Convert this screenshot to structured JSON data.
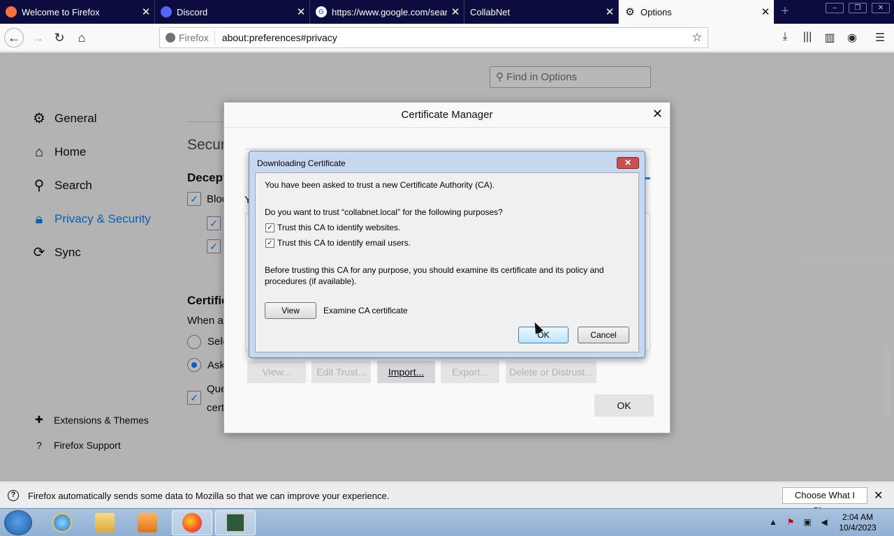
{
  "tabs": [
    {
      "title": "Welcome to Firefox",
      "icon": "firefox-icon"
    },
    {
      "title": "Discord",
      "icon": "discord-icon"
    },
    {
      "title": "https://www.google.com/sear",
      "icon": "google-icon"
    },
    {
      "title": "CollabNet",
      "icon": ""
    },
    {
      "title": "Options",
      "icon": "gear-icon"
    }
  ],
  "urlbar": {
    "identity": "Firefox",
    "url": "about:preferences#privacy"
  },
  "find": {
    "placeholder": "Find in Options"
  },
  "categories": [
    {
      "label": "General",
      "icon": "gear-icon"
    },
    {
      "label": "Home",
      "icon": "home-icon"
    },
    {
      "label": "Search",
      "icon": "search-icon"
    },
    {
      "label": "Privacy & Security",
      "icon": "lock-icon"
    },
    {
      "label": "Sync",
      "icon": "sync-icon"
    }
  ],
  "footer_links": [
    {
      "label": "Extensions & Themes",
      "icon": "puzzle-icon"
    },
    {
      "label": "Firefox Support",
      "icon": "help-icon"
    }
  ],
  "background": {
    "section_security": "Securi",
    "heading_deceptive": "Decept",
    "block_fragment": "Bloc",
    "cert_heading": "Certific",
    "when_a": "When a",
    "sel_fragment": "Sele",
    "ask_fragment": "Ask",
    "que_fragment": "Que",
    "cert_fragment": "certi",
    "y_fragment": "Y"
  },
  "cert_manager": {
    "title": "Certificate Manager",
    "buttons": [
      "View...",
      "Edit Trust...",
      "Import...",
      "Export...",
      "Delete or Distrust..."
    ],
    "ok": "OK"
  },
  "download_dialog": {
    "title": "Downloading Certificate",
    "intro": "You have been asked to trust a new Certificate Authority (CA).",
    "question": "Do you want to trust “collabnet.local” for the following purposes?",
    "cb_websites": "Trust this CA to identify websites.",
    "cb_email": "Trust this CA to identify email users.",
    "cb_websites_checked": true,
    "cb_email_checked": true,
    "warning_line1": "Before trusting this CA for any purpose, you should examine its certificate and its policy and",
    "warning_line2": "procedures (if available).",
    "view_button": "View",
    "view_caption": "Examine CA certificate",
    "ok_button": "OK",
    "cancel_button": "Cancel"
  },
  "notification": {
    "text": "Firefox automatically sends some data to Mozilla so that we can improve your experience.",
    "button": "Choose What I Share"
  },
  "taskbar": {
    "clock_time": "2:04 AM",
    "clock_date": "10/4/2023"
  },
  "colors": {
    "accent": "#0a84ff",
    "tabstrip": "#0c0c3f",
    "dialog_frame": "#c7d8ee"
  }
}
